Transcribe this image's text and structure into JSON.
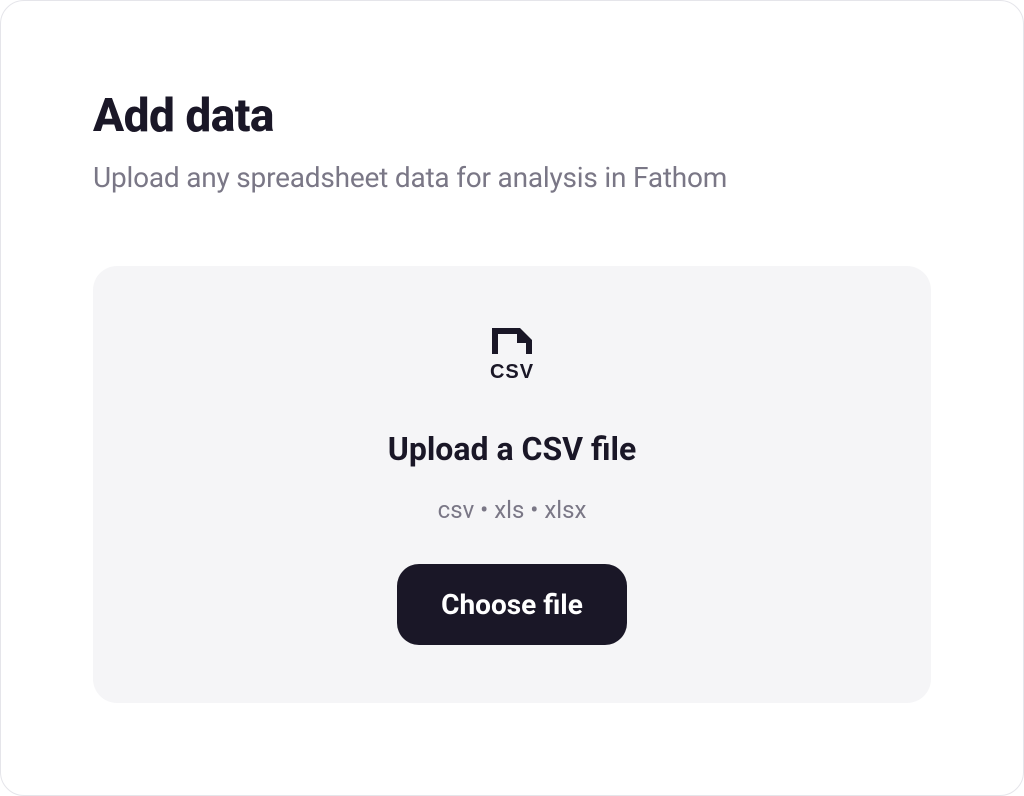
{
  "header": {
    "title": "Add data",
    "subtitle": "Upload any spreadsheet data for analysis in Fathom"
  },
  "upload": {
    "title": "Upload a CSV file",
    "file_types": "csv • xls • xlsx",
    "button_label": "Choose file",
    "icon_label": "CSV"
  }
}
